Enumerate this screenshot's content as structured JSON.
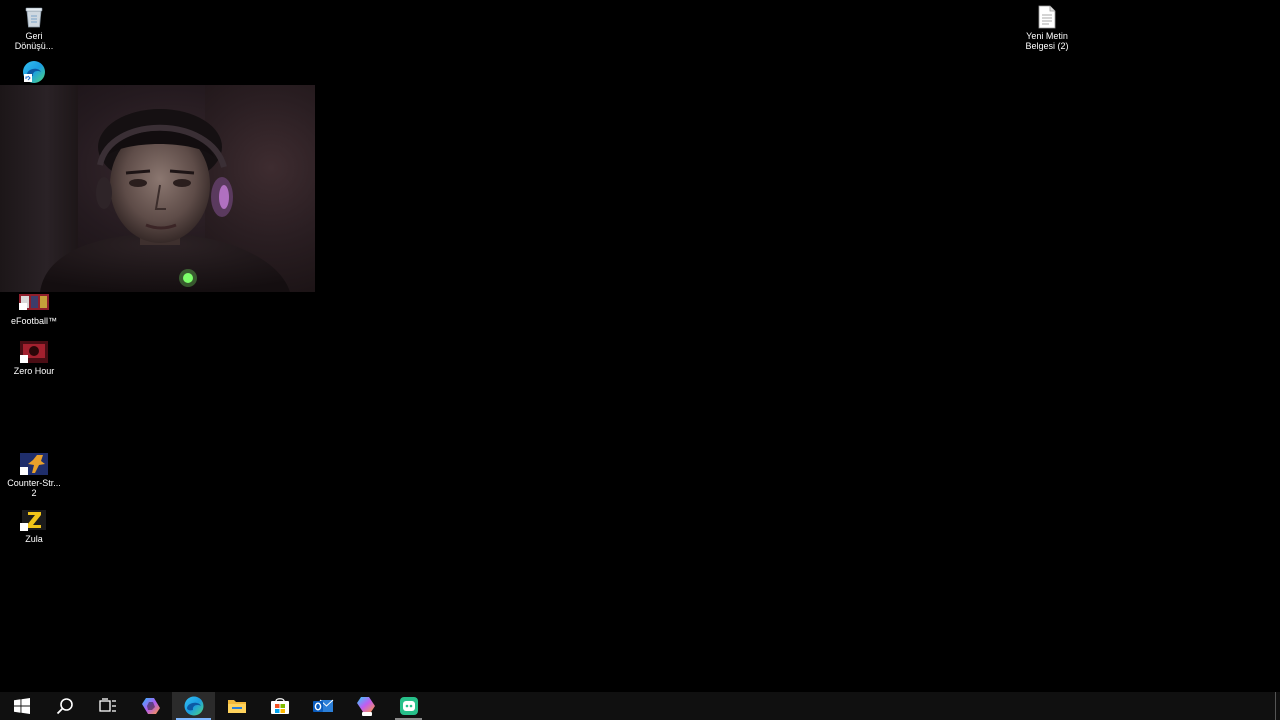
{
  "desktop": {
    "icons": [
      {
        "name": "recycle-bin",
        "label": "Geri\nDönüşü...",
        "icon": "recycle-bin-icon"
      },
      {
        "name": "edge",
        "label": "",
        "icon": "edge-icon"
      },
      {
        "name": "efootball",
        "label": "eFootball™",
        "icon": "efootball-icon"
      },
      {
        "name": "zero-hour",
        "label": "Zero Hour",
        "icon": "zero-hour-icon"
      },
      {
        "name": "counter-strike-2",
        "label": "Counter-Str...\n2",
        "icon": "counter-strike-icon"
      },
      {
        "name": "zula",
        "label": "Zula",
        "icon": "zula-icon"
      },
      {
        "name": "yeni-metin-belgesi",
        "label": "Yeni Metin\nBelgesi (2)",
        "icon": "text-file-icon"
      }
    ]
  },
  "webcam": {
    "icon": "webcam-person-image"
  },
  "taskbar": {
    "items": [
      {
        "name": "start",
        "icon": "windows-logo-icon"
      },
      {
        "name": "search",
        "icon": "search-icon"
      },
      {
        "name": "task-view",
        "icon": "task-view-icon"
      },
      {
        "name": "copilot",
        "icon": "copilot-icon"
      },
      {
        "name": "edge",
        "icon": "edge-icon",
        "state": "active"
      },
      {
        "name": "file-explorer",
        "icon": "folder-icon"
      },
      {
        "name": "microsoft-store",
        "icon": "store-icon"
      },
      {
        "name": "outlook",
        "icon": "outlook-icon"
      },
      {
        "name": "copilot-preview",
        "icon": "copilot-preview-icon"
      },
      {
        "name": "discord",
        "icon": "discord-icon",
        "state": "open"
      }
    ]
  },
  "colors": {
    "desktop_bg": "#000000",
    "taskbar_bg": "#101010",
    "active_indicator": "#7fb8ff"
  }
}
